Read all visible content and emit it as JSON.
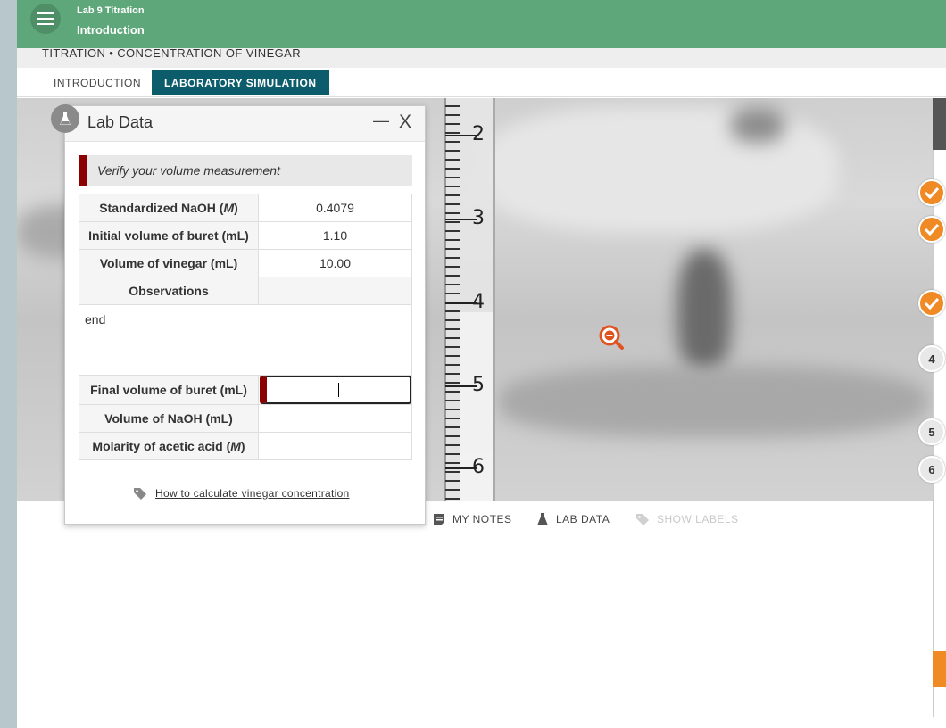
{
  "header": {
    "course": "Lab 9 Titration",
    "page": "Introduction"
  },
  "breadcrumb": "TITRATION • CONCENTRATION OF VINEGAR",
  "tabs": [
    {
      "label": "INTRODUCTION",
      "active": false
    },
    {
      "label": "LABORATORY SIMULATION",
      "active": true
    }
  ],
  "scene": {
    "buret_labels": [
      "2",
      "3",
      "4",
      "5",
      "6"
    ],
    "zoom_icon": "zoom-out-icon"
  },
  "steps": [
    {
      "label": "",
      "state": "done"
    },
    {
      "label": "",
      "state": "done"
    },
    {
      "label": "",
      "state": "done"
    },
    {
      "label": "4",
      "state": "todo"
    },
    {
      "label": "5",
      "state": "todo"
    },
    {
      "label": "6",
      "state": "todo"
    }
  ],
  "toolbar": {
    "notes": "MY NOTES",
    "lab_data": "LAB DATA",
    "show_labels": "SHOW LABELS"
  },
  "dialog": {
    "title": "Lab Data",
    "minimize": "—",
    "close": "X",
    "verify_message": "Verify your volume measurement",
    "rows": {
      "naoh_label": "Standardized NaOH (",
      "naoh_unit": "M",
      "naoh_value": "0.4079",
      "initial_label": "Initial volume of buret (mL)",
      "initial_value": "1.10",
      "vinegar_label": "Volume of vinegar (mL)",
      "vinegar_value": "10.00",
      "observations_label": "Observations",
      "observations_text": "end",
      "final_label": "Final volume of buret (mL)",
      "final_value": "",
      "volume_naoh_label": "Volume of NaOH (mL)",
      "molarity_label": "Molarity of acetic acid (",
      "molarity_unit": "M"
    },
    "howto": "How to calculate vinegar concentration"
  },
  "colors": {
    "header_green": "#5ea77a",
    "tab_active": "#0d5c6b",
    "alert_red": "#8b0000",
    "step_orange": "#f08a24"
  }
}
